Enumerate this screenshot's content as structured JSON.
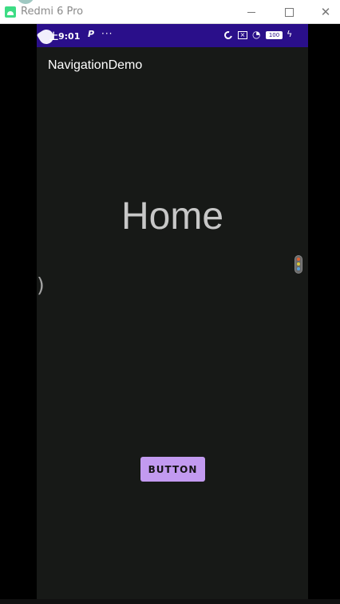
{
  "window": {
    "title": "Redmi 6 Pro",
    "minimize_icon": "minimize-icon",
    "maximize_icon": "maximize-icon",
    "close_icon": "close-icon"
  },
  "statusbar": {
    "time": "上9:01",
    "p_label": "P",
    "more_dots": "···",
    "battery": "100",
    "icons": [
      "moon-icon",
      "sim-x-icon",
      "wifi-icon",
      "battery-icon",
      "charging-icon"
    ]
  },
  "app": {
    "title": "NavigationDemo",
    "home_heading": "Home",
    "button_label": "BUTTON",
    "back_gesture": ")"
  },
  "colors": {
    "statusbar_bg": "#2a0f8a",
    "app_bg": "#171917",
    "button_bg": "#c29af0",
    "heading": "#c7c7c7"
  }
}
